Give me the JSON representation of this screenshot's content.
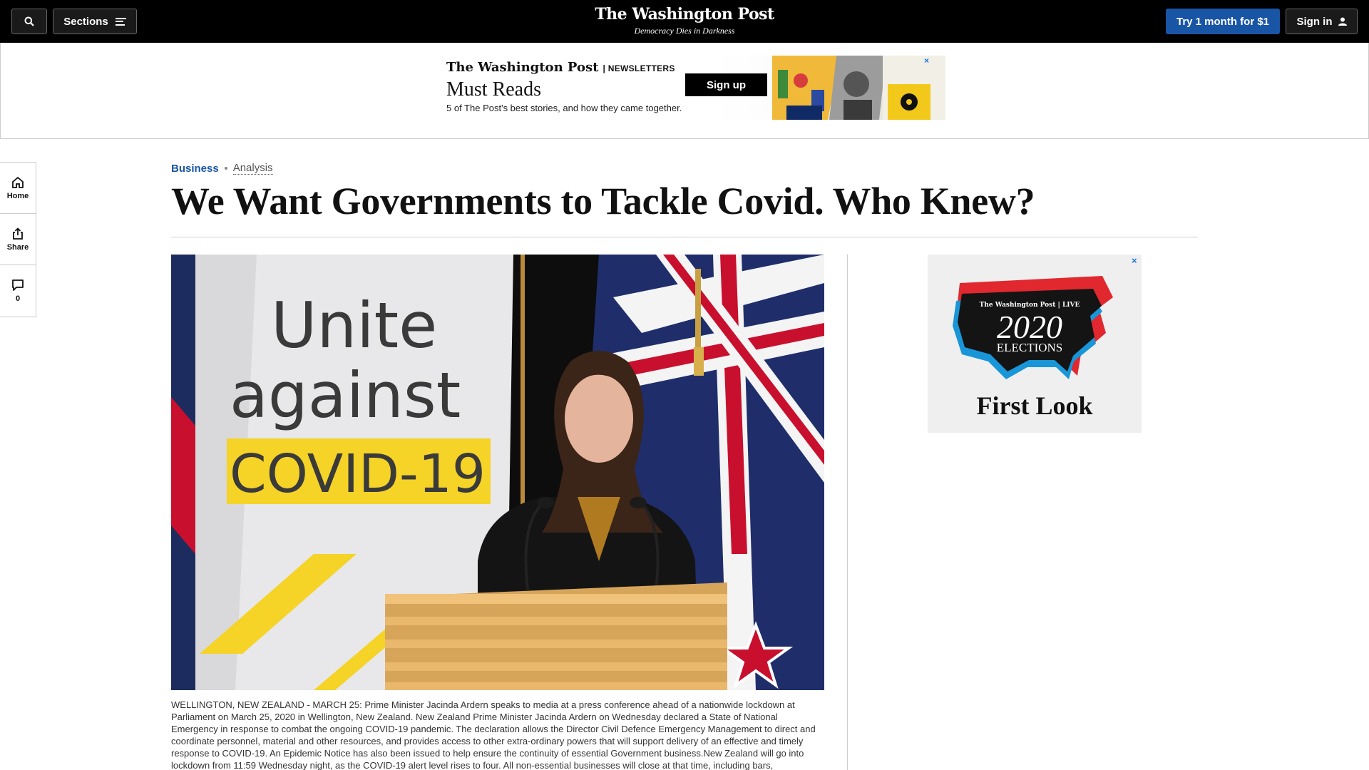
{
  "nav": {
    "sections_label": "Sections",
    "masthead": "The Washington Post",
    "tagline": "Democracy Dies in Darkness",
    "subscribe_label": "Try 1 month for $1",
    "signin_label": "Sign in"
  },
  "newsletter_ad": {
    "brand": "The Washington Post",
    "category": "NEWSLETTERS",
    "title": "Must Reads",
    "subtitle": "5 of The Post's best stories, and how they came together.",
    "button_label": "Sign up"
  },
  "rail": {
    "home_label": "Home",
    "share_label": "Share",
    "comments_count": "0"
  },
  "article": {
    "section": "Business",
    "label": "Analysis",
    "headline": "We Want Governments to Tackle Covid. Who Knew?",
    "photo_sign_lines": [
      "Unite",
      "against",
      "COVID-19"
    ],
    "caption": "WELLINGTON, NEW ZEALAND - MARCH 25: Prime Minister Jacinda Ardern speaks to media at a press conference ahead of a nationwide lockdown at Parliament on March 25, 2020 in Wellington, New Zealand. New Zealand Prime Minister Jacinda Ardern on Wednesday declared a State of National Emergency in response to combat the ongoing COVID-19 pandemic. The declaration allows the Director Civil Defence Emergency Management to direct and coordinate personnel, material and other resources, and provides access to other extra-ordinary powers that will support delivery of an effective and timely response to COVID-19. An Epidemic Notice has also been issued to help ensure the continuity of essential Government business.New Zealand will go into lockdown from 11:59 Wednesday night, as the COVID-19 alert level rises to four. All non-essential businesses will close at that time, including bars, restaurants,"
  },
  "side_ad": {
    "brand": "The Washington Post",
    "brand_tag": "LIVE",
    "year": "2020",
    "title": "ELECTIONS",
    "cta": "First Look"
  },
  "colors": {
    "accent": "#1955a5",
    "nav_bg": "#000000"
  }
}
